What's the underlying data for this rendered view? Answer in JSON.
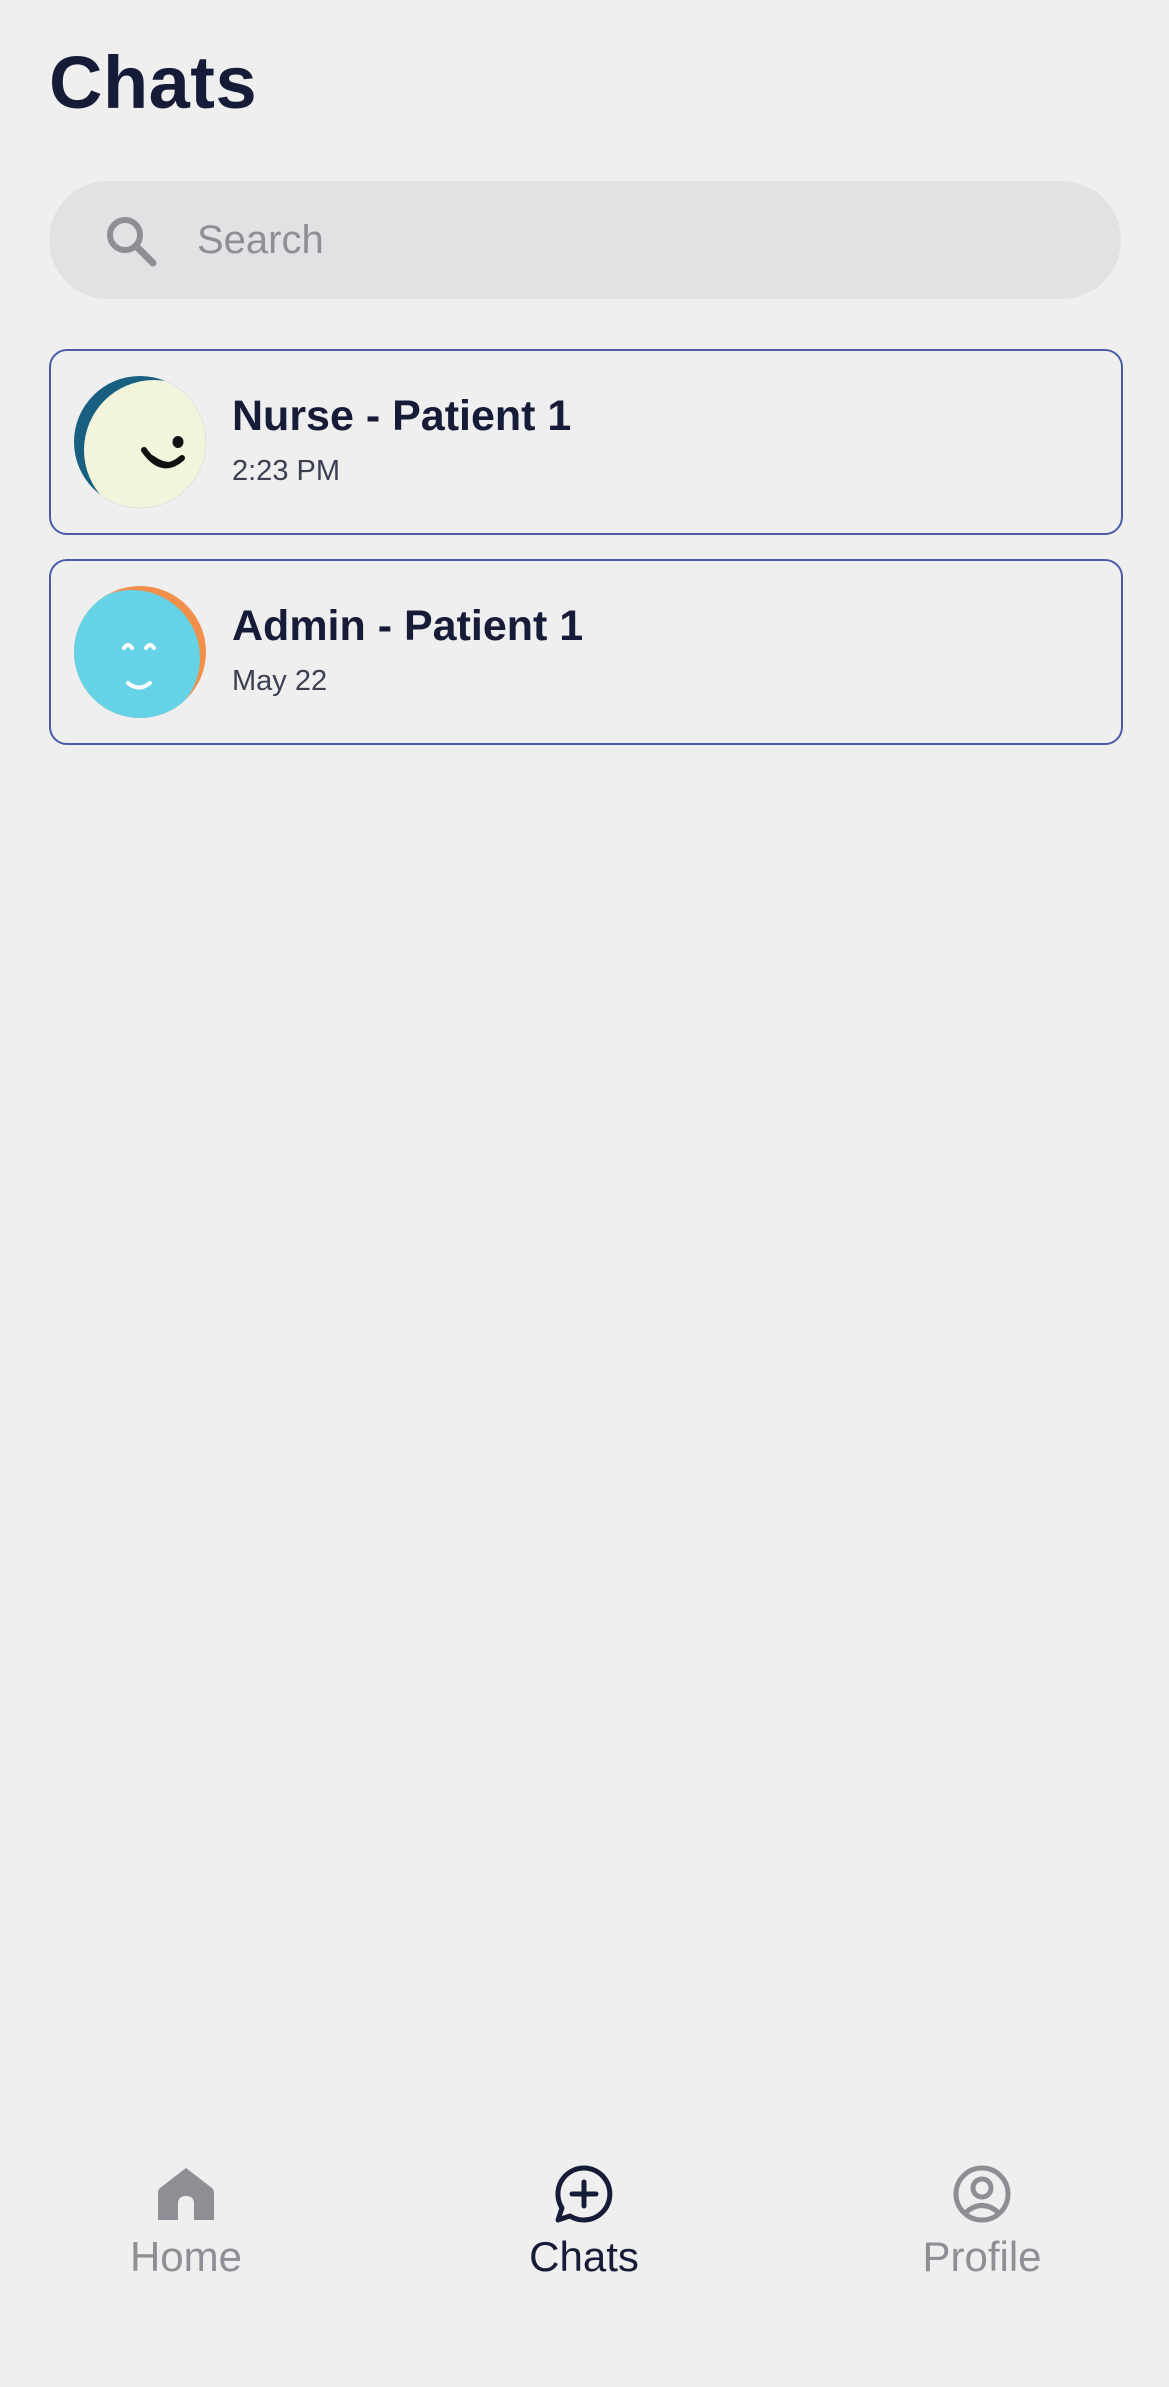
{
  "header": {
    "title": "Chats"
  },
  "search": {
    "placeholder": "Search",
    "value": "",
    "icon": "search-icon"
  },
  "chats": [
    {
      "name": "Nurse - Patient 1",
      "time": "2:23 PM",
      "avatar": {
        "icon": "smiley-avatar",
        "colors": {
          "back": "#185f80",
          "face": "#f2f4dc",
          "features": "#111111"
        }
      }
    },
    {
      "name": "Admin - Patient 1",
      "time": "May 22",
      "avatar": {
        "icon": "smiley-avatar",
        "colors": {
          "back": "#f28f4a",
          "face": "#66d2e6",
          "features": "#ffffff"
        }
      }
    }
  ],
  "tabbar": {
    "tabs": [
      {
        "label": "Home",
        "icon": "home-icon",
        "active": false
      },
      {
        "label": "Chats",
        "icon": "chat-plus-icon",
        "active": true
      },
      {
        "label": "Profile",
        "icon": "profile-icon",
        "active": false
      }
    ]
  },
  "colors": {
    "background": "#efeff0",
    "text_primary": "#161b38",
    "text_muted": "#8e8e95",
    "card_border": "#4b5ba8",
    "search_bg": "#e2e2e5"
  }
}
